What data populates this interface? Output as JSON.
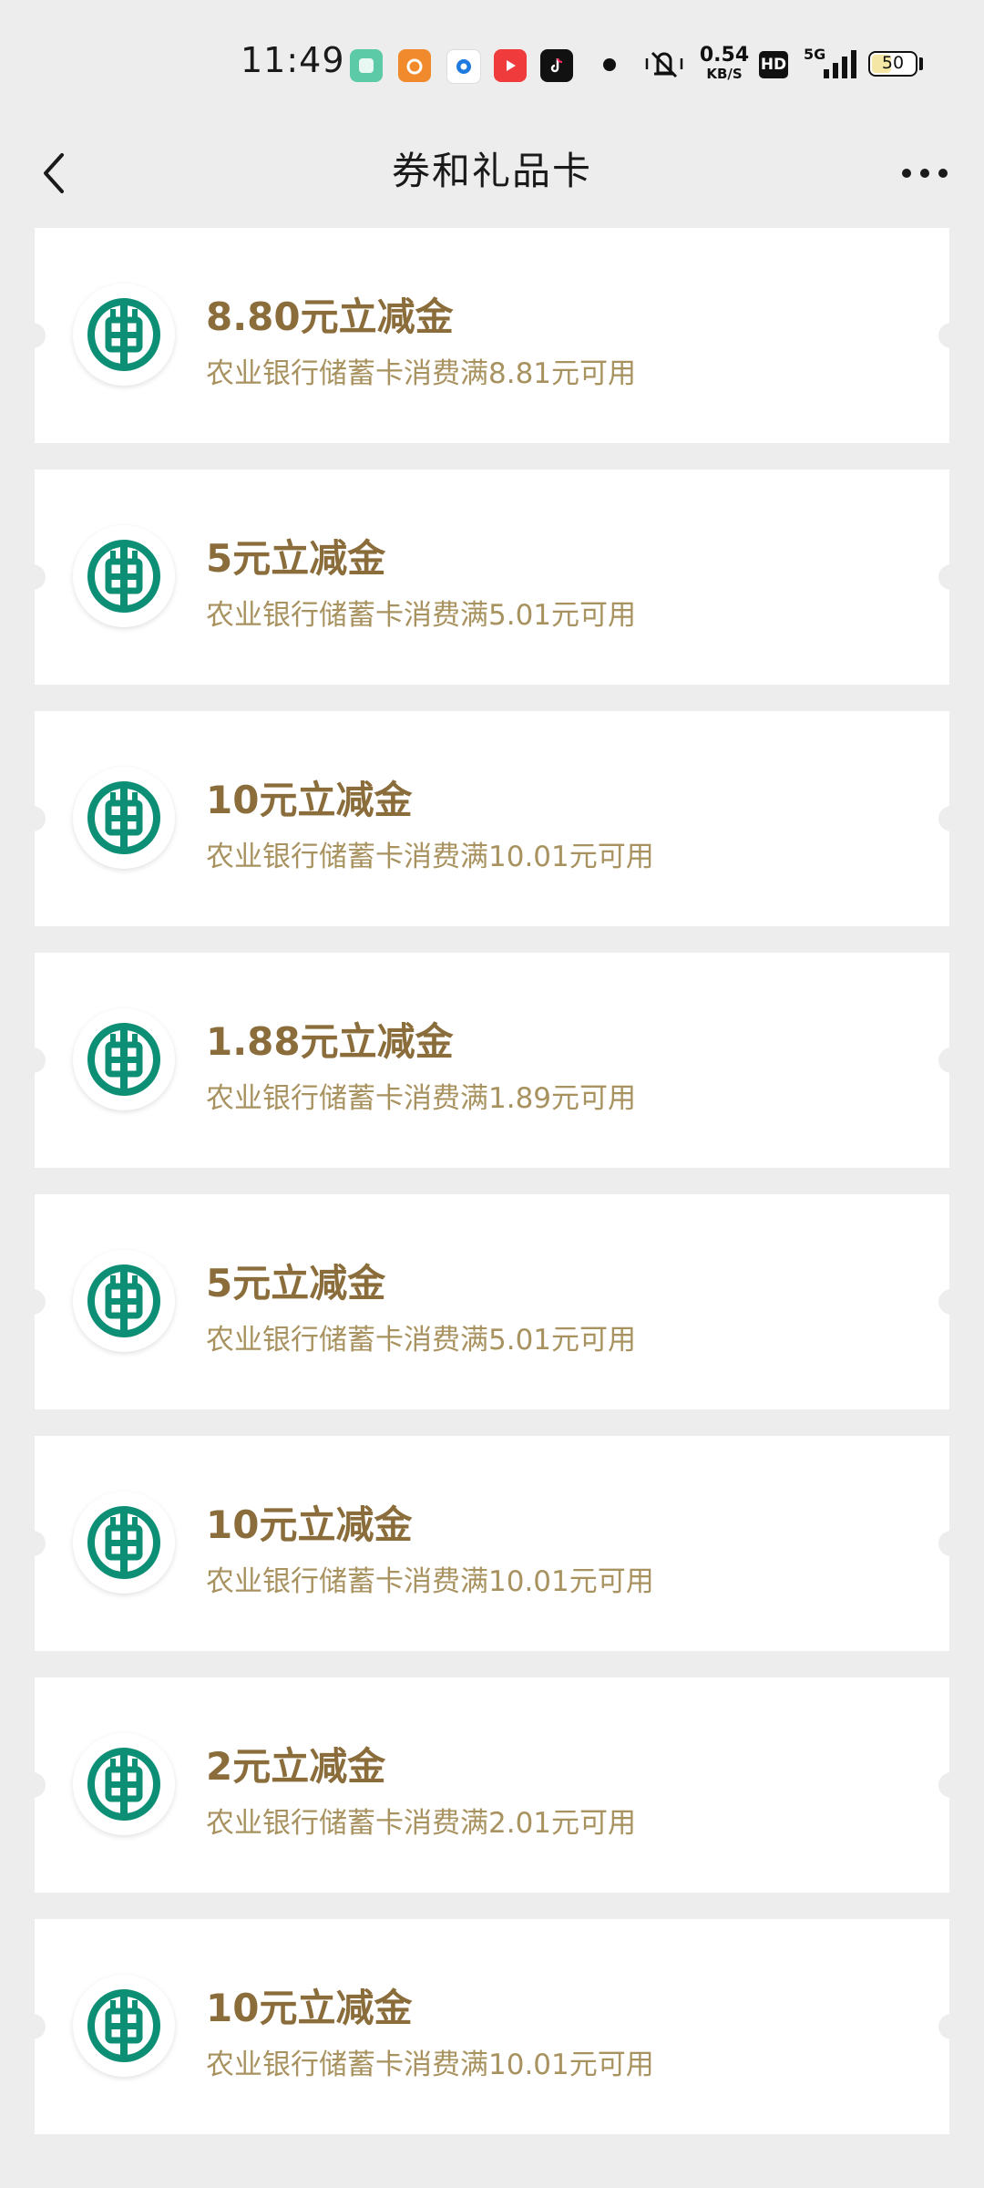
{
  "status_bar": {
    "time": "11:49",
    "net_speed_value": "0.54",
    "net_speed_unit": "KB/S",
    "hd_label": "HD",
    "signal_label": "5G",
    "battery_level": "50",
    "battery_fraction": 0.5
  },
  "header": {
    "title": "券和礼品卡"
  },
  "coupons": [
    {
      "title": "8.80元立减金",
      "description": "农业银行储蓄卡消费满8.81元可用"
    },
    {
      "title": "5元立减金",
      "description": "农业银行储蓄卡消费满5.01元可用"
    },
    {
      "title": "10元立减金",
      "description": "农业银行储蓄卡消费满10.01元可用"
    },
    {
      "title": "1.88元立减金",
      "description": "农业银行储蓄卡消费满1.89元可用"
    },
    {
      "title": "5元立减金",
      "description": "农业银行储蓄卡消费满5.01元可用"
    },
    {
      "title": "10元立减金",
      "description": "农业银行储蓄卡消费满10.01元可用"
    },
    {
      "title": "2元立减金",
      "description": "农业银行储蓄卡消费满2.01元可用"
    },
    {
      "title": "10元立减金",
      "description": "农业银行储蓄卡消费满10.01元可用"
    }
  ],
  "colors": {
    "background": "#ededed",
    "card": "#ffffff",
    "coupon_title": "#8a6d3b",
    "coupon_desc": "#a8925f",
    "bank_logo": "#0d8f75"
  },
  "icons": {
    "back": "back-arrow-icon",
    "more": "more-dots-icon",
    "bank_logo": "abc-bank-logo-icon"
  }
}
